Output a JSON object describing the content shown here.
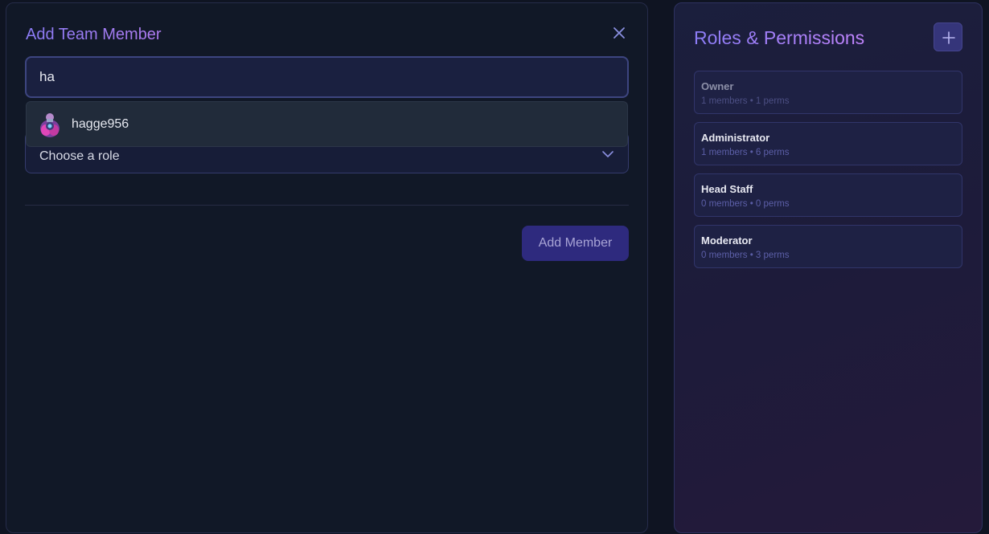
{
  "add_member": {
    "title": "Add Team Member",
    "search_value": "ha",
    "role_select_label": "Choose a role",
    "suggestions": [
      {
        "username": "hagge956"
      }
    ],
    "submit_label": "Add Member"
  },
  "roles": {
    "title": "Roles & Permissions",
    "items": [
      {
        "name": "Owner",
        "meta": "1 members • 1 perms"
      },
      {
        "name": "Administrator",
        "meta": "1 members • 6 perms"
      },
      {
        "name": "Head Staff",
        "meta": "0 members • 0 perms"
      },
      {
        "name": "Moderator",
        "meta": "0 members • 3 perms"
      }
    ]
  },
  "colors": {
    "background": "#0f1422",
    "accent": "#8b7cf6",
    "button": "#2e2a7e"
  },
  "icons": [
    "close-icon",
    "chevron-down-icon",
    "plus-icon",
    "avatar"
  ]
}
